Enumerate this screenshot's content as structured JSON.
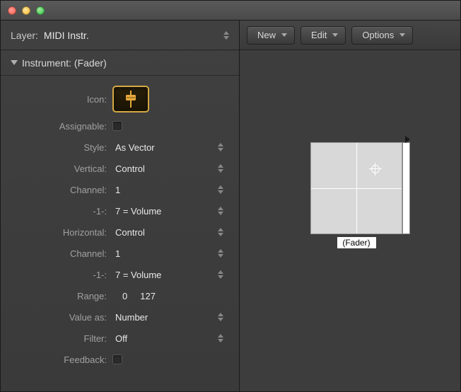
{
  "header": {
    "layer_label": "Layer:",
    "layer_value": "MIDI Instr."
  },
  "section": {
    "title": "Instrument: (Fader)"
  },
  "props": {
    "icon": {
      "label": "Icon:"
    },
    "assignable": {
      "label": "Assignable:"
    },
    "style": {
      "label": "Style:",
      "value": "As Vector"
    },
    "vertical": {
      "label": "Vertical:",
      "value": "Control"
    },
    "v_channel": {
      "label": "Channel:",
      "value": "1"
    },
    "v_minus1": {
      "label": "-1-:",
      "value": "7 = Volume"
    },
    "horizontal": {
      "label": "Horizontal:",
      "value": "Control"
    },
    "h_channel": {
      "label": "Channel:",
      "value": "1"
    },
    "h_minus1": {
      "label": "-1-:",
      "value": "7 = Volume"
    },
    "range": {
      "label": "Range:",
      "low": "0",
      "high": "127"
    },
    "value_as": {
      "label": "Value as:",
      "value": "Number"
    },
    "filter": {
      "label": "Filter:",
      "value": "Off"
    },
    "feedback": {
      "label": "Feedback:"
    }
  },
  "toolbar": {
    "new_label": "New",
    "edit_label": "Edit",
    "options_label": "Options"
  },
  "canvas": {
    "object_label": "(Fader)"
  },
  "colors": {
    "icon_accent": "#e6a93c"
  }
}
